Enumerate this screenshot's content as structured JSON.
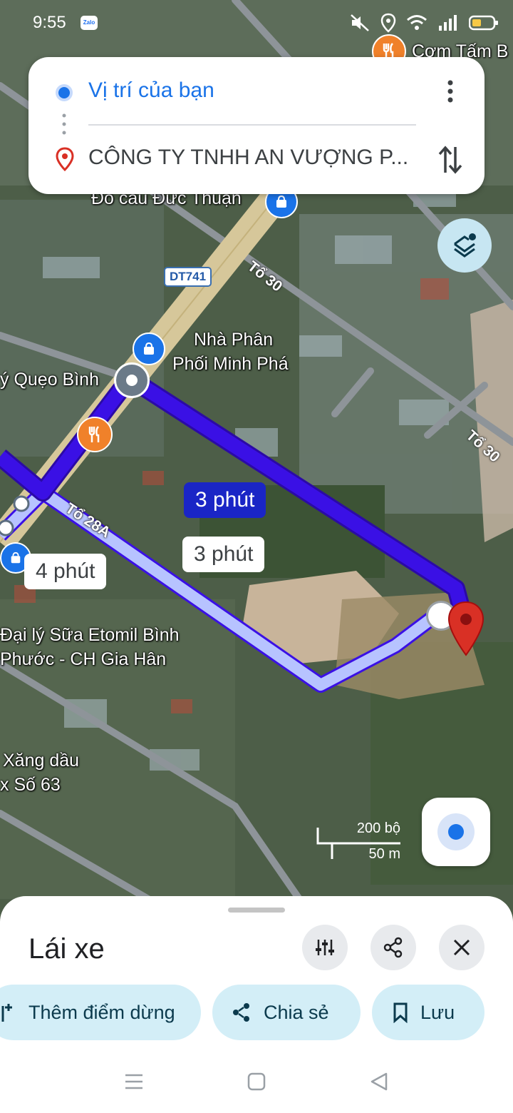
{
  "status_bar": {
    "time": "9:55",
    "app_badge": "Zalo"
  },
  "route": {
    "origin": "Vị trí của bạn",
    "destination": "CÔNG TY TNHH AN VƯỢNG P..."
  },
  "map_labels": {
    "restaurant_top": "Cơm Tấm B",
    "shop_top": "Đồ câu Đức Thuận",
    "road_dt741": "DT741",
    "road_to30_a": "Tổ 30",
    "road_to30_b": "Tổ 30",
    "nha_phan_line1": "Nhà Phân",
    "nha_phan_line2": "Phối Minh Phá",
    "queo_binh": "ý Quẹo Bình",
    "road_to28a": "Tổ 28A",
    "etomil_line1": "Đại lý Sữa Etomil Bình",
    "etomil_line2": "Phước - CH Gia Hân",
    "xang_line1": "Xăng dầu",
    "xang_line2": "x Số 63"
  },
  "route_badges": {
    "primary": "3 phút",
    "alt1": "3 phút",
    "alt2": "4 phút"
  },
  "scale": {
    "top": "200 bộ",
    "bottom": "50 m"
  },
  "sheet": {
    "title": "Lái xe",
    "chips": {
      "add_stop": "Thêm điểm dừng",
      "share": "Chia sẻ",
      "save": "Lưu"
    }
  },
  "colors": {
    "route_primary": "#3a10e5",
    "route_alt": "#b7c3ff",
    "chip_bg": "#d3eef7",
    "accent_blue": "#1a73e8",
    "pin_red": "#d93025"
  }
}
